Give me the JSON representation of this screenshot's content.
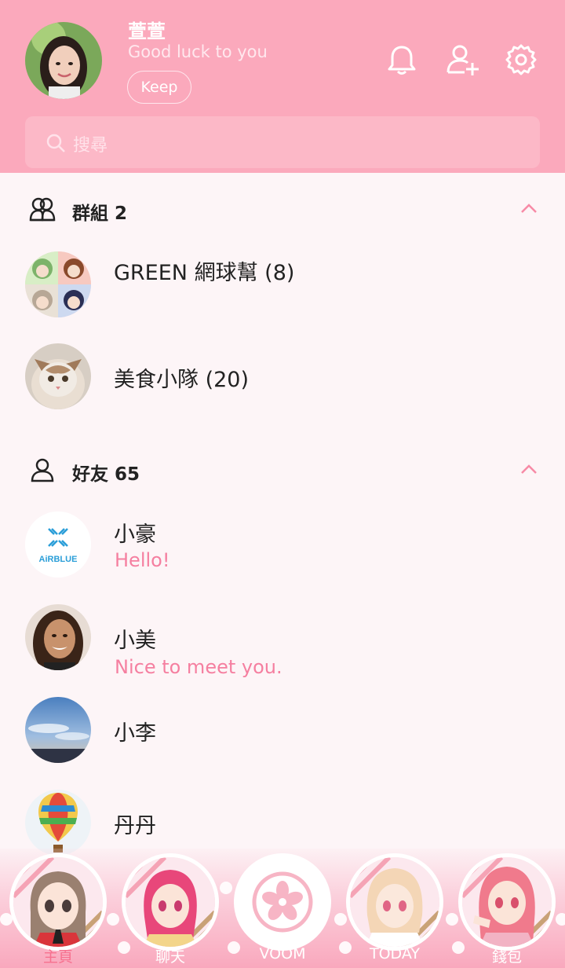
{
  "profile": {
    "name": "萱萱",
    "status": "Good luck to you",
    "keep_label": "Keep"
  },
  "search": {
    "placeholder": "搜尋"
  },
  "groups": {
    "title": "群組 2",
    "items": [
      {
        "name": "GREEN 網球幫 (8)"
      },
      {
        "name": "美食小隊 (20)"
      }
    ]
  },
  "friends": {
    "title": "好友 65",
    "items": [
      {
        "name": "小豪",
        "status": "Hello!",
        "avatar_text": "AiRBLUE"
      },
      {
        "name": "小美",
        "status": "Nice to meet you."
      },
      {
        "name": "小李"
      },
      {
        "name": "丹丹"
      }
    ]
  },
  "nav": {
    "tabs": [
      {
        "label": "主頁"
      },
      {
        "label": "聊天"
      },
      {
        "label": "VOOM"
      },
      {
        "label": "TODAY"
      },
      {
        "label": "錢包"
      }
    ]
  },
  "colors": {
    "header": "#fba9bc",
    "accent": "#f57fa0",
    "background": "#fdf5f7"
  },
  "icons": [
    "bell-icon",
    "add-friend-icon",
    "settings-icon",
    "search-icon",
    "group-icon",
    "friend-icon",
    "chevron-up-icon",
    "sakura-icon"
  ]
}
